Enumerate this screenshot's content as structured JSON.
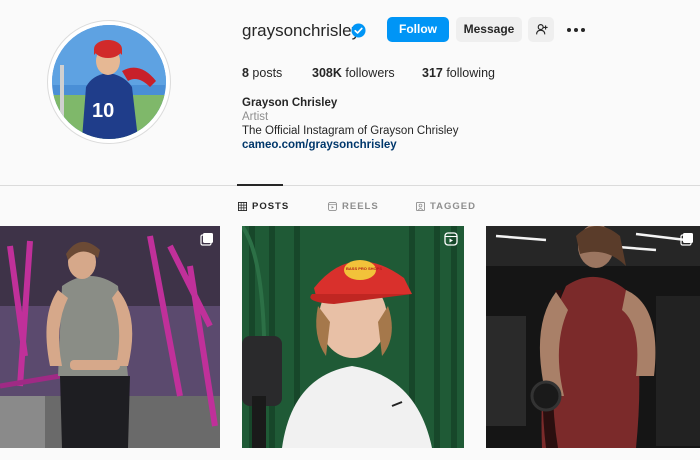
{
  "profile": {
    "username": "graysonchrisley",
    "verified": true,
    "full_name": "Grayson Chrisley",
    "category": "Artist",
    "bio": "The Official Instagram of Grayson Chrisley",
    "link": "cameo.com/graysonchrisley",
    "jersey_number": "10"
  },
  "actions": {
    "follow_label": "Follow",
    "message_label": "Message"
  },
  "stats": {
    "posts_count": "8",
    "posts_label": " posts",
    "followers_count": "308K",
    "followers_label": " followers",
    "following_count": "317",
    "following_label": " following"
  },
  "tabs": [
    {
      "label": "POSTS",
      "icon": "grid-icon",
      "active": true
    },
    {
      "label": "REELS",
      "icon": "reels-icon",
      "active": false
    },
    {
      "label": "TAGGED",
      "icon": "tagged-icon",
      "active": false
    }
  ],
  "posts": [
    {
      "type": "carousel",
      "badge_icon": "carousel-icon"
    },
    {
      "type": "reel",
      "badge_icon": "reel-icon",
      "hat_text": "BASS PRO SHOPS"
    },
    {
      "type": "carousel",
      "badge_icon": "carousel-icon"
    }
  ],
  "colors": {
    "accent": "#0095f6",
    "background": "#fafafa",
    "text": "#262626",
    "secondary": "#8e8e8e",
    "link": "#00376b"
  }
}
